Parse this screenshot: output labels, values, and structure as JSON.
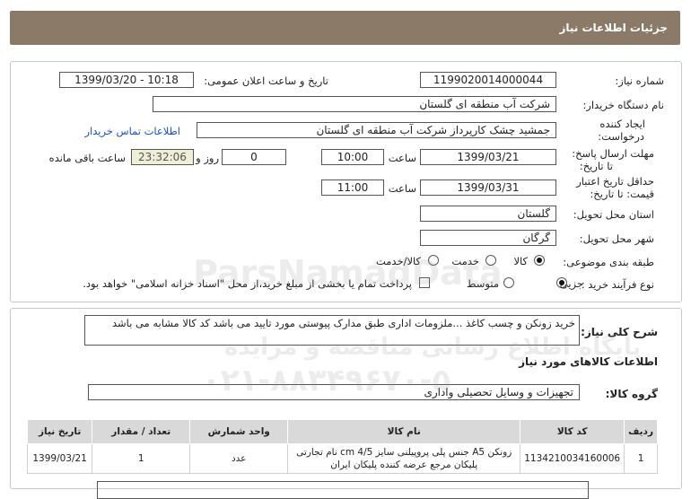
{
  "header": {
    "title": "جزئیات اطلاعات نیاز"
  },
  "form": {
    "need_number_label": "شماره نیاز:",
    "need_number": "1199020014000044",
    "announce_label": "تاریخ و ساعت اعلان عمومی:",
    "announce_value": "1399/03/20 - 10:18",
    "buyer_org_label": "نام دستگاه خریدار:",
    "buyer_org": "شرکت آب منطقه ای گلستان",
    "creator_label_1": "ایجاد کننده",
    "creator_label_2": "درخواست:",
    "creator": "جمشید چشک کارپرداز شرکت آب منطقه ای گلستان",
    "contact_link": "اطلاعات تماس خریدار",
    "reply_deadline_label_1": "مهلت ارسال پاسخ:",
    "reply_deadline_label_2": "تا تاریخ:",
    "reply_date": "1399/03/21",
    "time_label": "ساعت",
    "reply_time": "10:00",
    "days_value": "0",
    "days_label": "روز و",
    "remaining_time": "23:32:06",
    "remaining_label": "ساعت باقی مانده",
    "validity_label_1": "حداقل تاریخ اعتبار",
    "validity_label_2": "قیمت: تا تاریخ:",
    "validity_date": "1399/03/31",
    "validity_time_label": "ساعت",
    "validity_time": "11:00",
    "province_label": "استان محل تحویل:",
    "province": "گلستان",
    "city_label": "شهر محل تحویل:",
    "city": "گرگان",
    "category_label": "طبقه بندی موضوعی:",
    "category_options": [
      "کالا",
      "خدمت",
      "کالا/خدمت"
    ],
    "category_selected": "کالا",
    "process_label": "نوع فرآیند خرید :",
    "process_options": [
      "جزیی",
      "متوسط"
    ],
    "process_selected": "جزیی",
    "payment_note": "پرداخت تمام یا بخشی از مبلغ خرید،از محل \"اسناد خزانه اسلامی\" خواهد بود."
  },
  "description": {
    "label": "شرح کلی نیاز:",
    "text": "خرید زونکن و چسب کاغذ ...ملزومات اداری طبق مدارک پیوستی مورد تایید می باشد کد کالا مشابه می باشد"
  },
  "goods": {
    "section_title": "اطلاعات کالاهای مورد نیاز",
    "group_label": "گروه کالا:",
    "group_value": "تجهیزات و وسایل تحصیلی واداری",
    "columns": [
      "ردیف",
      "کد کالا",
      "نام کالا",
      "واحد شمارش",
      "تعداد / مقدار",
      "تاریخ نیاز"
    ],
    "rows": [
      {
        "row": "1",
        "code": "1134210034160006",
        "name_1": "زونکن A5 جنس پلی پروپیلنی سایز cm 4/5 نام تجارتی",
        "name_2": "پلیکان مرجع عرضه کننده پلیکان ایران",
        "unit": "عدد",
        "qty": "1",
        "date": "1399/03/21"
      }
    ]
  },
  "watermark": {
    "line1": "ParsNamadData",
    "line2": "پایگاه اطلاع رسانی مناقصه و مزایده",
    "line3": "۰۲۱-۸۸۳۴۹۶۷۰-۵"
  }
}
